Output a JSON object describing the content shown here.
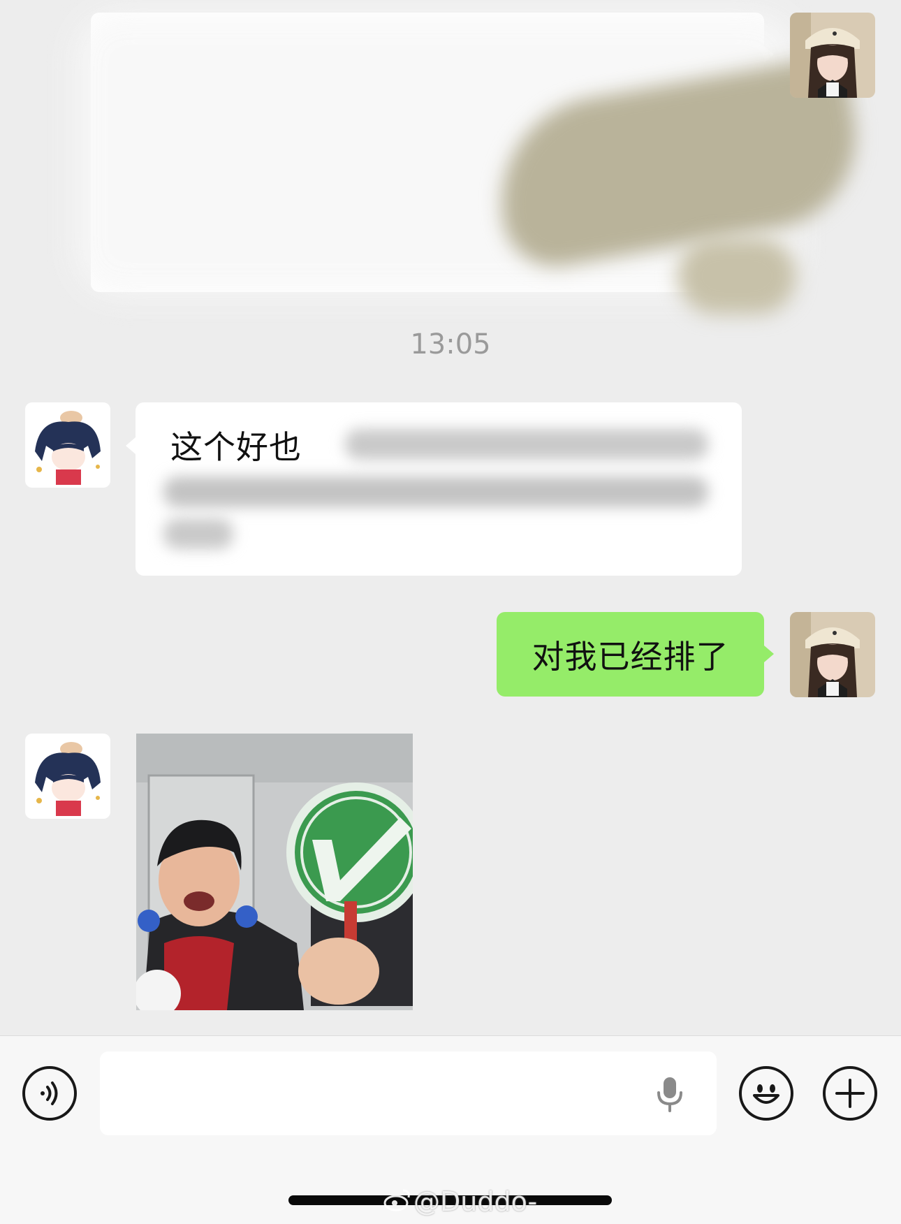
{
  "colors": {
    "background": "#ededed",
    "incoming_bubble": "#ffffff",
    "outgoing_bubble": "#95ec69",
    "input_bar": "#f7f7f7",
    "timestamp_text": "#9a9a9a"
  },
  "chat": {
    "timestamp": "13:05",
    "messages": [
      {
        "direction": "outgoing",
        "type": "text",
        "content": "",
        "redacted": true,
        "avatar": "girl-cap-avatar"
      },
      {
        "direction": "incoming",
        "type": "text",
        "content": "这个好也",
        "redacted": true,
        "avatar": "anime-boy-avatar"
      },
      {
        "direction": "outgoing",
        "type": "text",
        "content": "对我已经排了",
        "redacted": false,
        "avatar": "girl-cap-avatar"
      },
      {
        "direction": "incoming",
        "type": "sticker",
        "sticker": "checkmark-sign-meme-sticker",
        "avatar": "anime-boy-avatar"
      }
    ]
  },
  "input_bar": {
    "voice_toggle_icon": "voice-mode-icon",
    "text_value": "",
    "mic_icon": "microphone-icon",
    "emoji_icon": "emoji-icon",
    "more_icon": "plus-icon"
  },
  "watermark": {
    "icon": "weibo-icon",
    "text": "@Duddo-"
  }
}
